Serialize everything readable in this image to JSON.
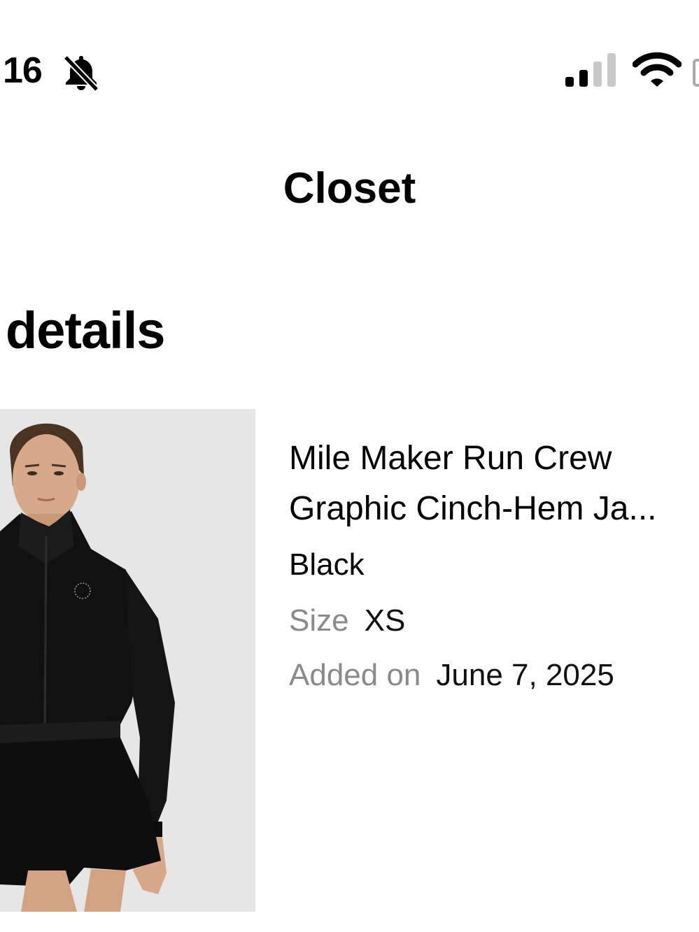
{
  "status_bar": {
    "time": "16",
    "icons": [
      "bell-slash-icon",
      "cellular-signal-icon",
      "wifi-icon",
      "battery-icon"
    ]
  },
  "nav": {
    "title": "Closet"
  },
  "section": {
    "heading": "details"
  },
  "product": {
    "image_alt": "Model wearing black cropped jacket and black shorts",
    "name_line1": "Mile Maker Run Crew",
    "name_line2": "Graphic Cinch-Hem Ja...",
    "color": "Black",
    "size_label": "Size",
    "size_value": "XS",
    "added_label": "Added on",
    "added_value": "June 7, 2025"
  },
  "colors": {
    "text_primary": "#000000",
    "text_secondary": "#8a8a8a",
    "image_background": "#e6e6e6"
  }
}
